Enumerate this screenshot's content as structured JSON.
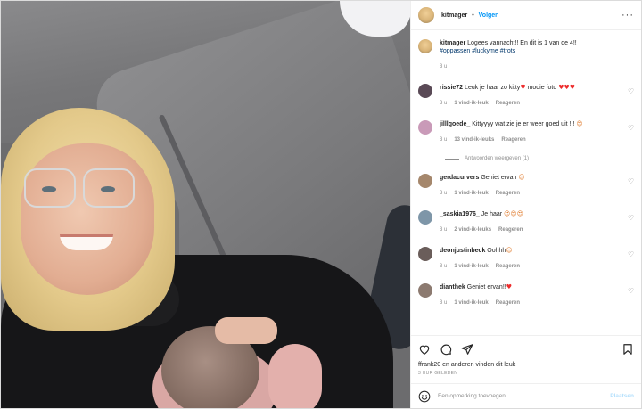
{
  "post": {
    "username": "kitmager",
    "follow_label": "Volgen",
    "separator": "•",
    "more_label": "···",
    "caption_text": "Logees vannacht!! En dit is 1 van de 4!!",
    "caption_tags": "#oppassen #luckyme #trots",
    "caption_time": "3 u"
  },
  "comments": [
    {
      "user": "rissie72",
      "text": "Leuk je haar zo kitty",
      "emoji_a": "♥",
      "text2": " mooie foto",
      "emoji_b": "♥♥♥",
      "time": "3 u",
      "likes": "1 vind-ik-leuk",
      "reply": "Reageren",
      "avatar_color": "#5a4a56"
    },
    {
      "user": "jilllgoede_",
      "text": "Kittyyyy wat zie je er weer goed uit !!!",
      "emoji_a": "😍",
      "text2": "",
      "emoji_b": "",
      "time": "3 u",
      "likes": "13 vind-ik-leuks",
      "reply": "Reageren",
      "avatar_color": "#c99ab8"
    },
    {
      "user": "gerdacurvers",
      "text": "Geniet ervan",
      "emoji_a": "😍",
      "text2": "",
      "emoji_b": "",
      "time": "3 u",
      "likes": "1 vind-ik-leuk",
      "reply": "Reageren",
      "avatar_color": "#a5876c"
    },
    {
      "user": "_saskia1976_",
      "text": "Je haar",
      "emoji_a": "😍😍😍",
      "text2": "",
      "emoji_b": "",
      "time": "3 u",
      "likes": "2 vind-ik-leuks",
      "reply": "Reageren",
      "avatar_color": "#7e96a8"
    },
    {
      "user": "deonjustinbeck",
      "text": "Oohhh",
      "emoji_a": "😍",
      "text2": "",
      "emoji_b": "",
      "time": "3 u",
      "likes": "1 vind-ik-leuk",
      "reply": "Reageren",
      "avatar_color": "#6a5d5a"
    },
    {
      "user": "dianthek",
      "text": "Geniet ervan!!",
      "emoji_a": "♥",
      "text2": "",
      "emoji_b": "",
      "time": "3 u",
      "likes": "1 vind-ik-leuk",
      "reply": "Reageren",
      "avatar_color": "#8c7a70"
    }
  ],
  "view_replies": "Antwoorden weergeven (1)",
  "footer": {
    "likes_text": "ffrank20 en anderen vinden dit leuk",
    "time_text": "3 UUR GELEDEN",
    "comment_placeholder": "Een opmerking toevoegen...",
    "post_label": "Plaatsen"
  },
  "icons": [
    "heart-icon",
    "comment-icon",
    "share-icon",
    "bookmark-icon",
    "emoji-icon",
    "more-icon"
  ],
  "colors": {
    "accent": "#0095f6",
    "heart": "#ed2b2b",
    "muted": "#8e8e8e",
    "post_disabled": "#b2dffc"
  }
}
